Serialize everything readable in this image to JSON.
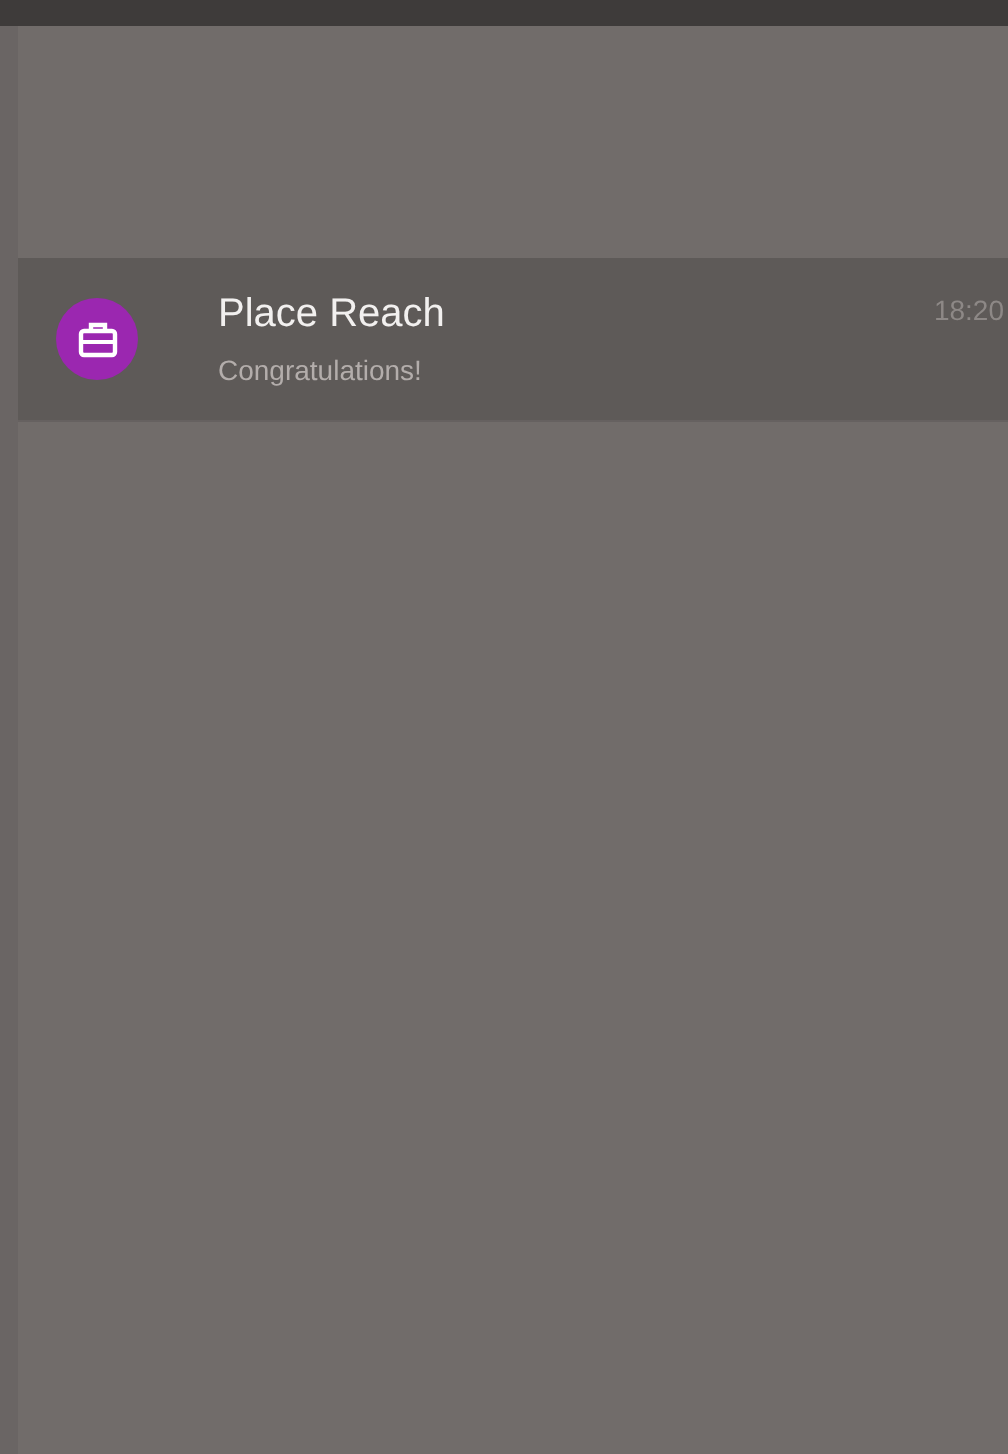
{
  "notifications": [
    {
      "title": "Place Reach",
      "text": "Congratulations!",
      "time": "18:20"
    }
  ]
}
